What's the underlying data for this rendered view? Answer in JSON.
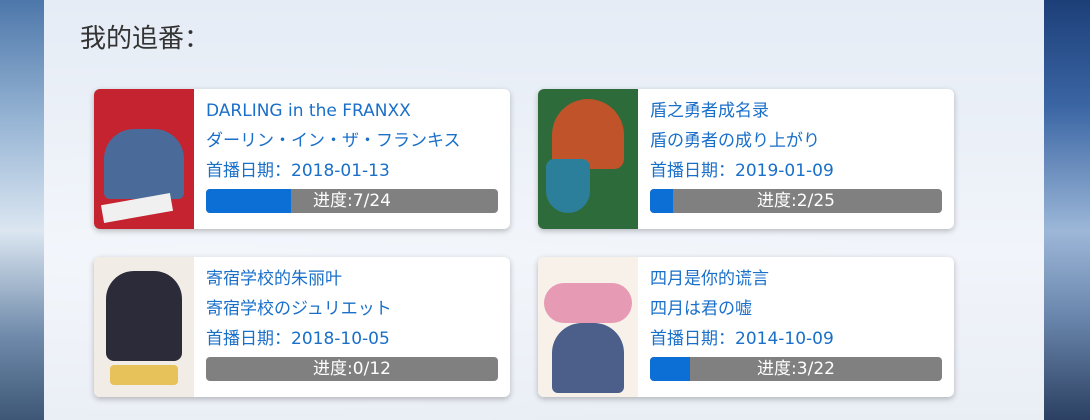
{
  "section": {
    "title": "我的追番："
  },
  "shows": [
    {
      "title_cn": "DARLING in the FRANXX",
      "title_jp": "ダーリン・イン・ザ・フランキス",
      "air_date_label": "首播日期：",
      "air_date": "2018-01-13",
      "progress_label": "进度:7/24",
      "progress": 0.2917,
      "cover_colors": [
        "#c4232f",
        "#4a6b9a",
        "#f0f0f0"
      ]
    },
    {
      "title_cn": "盾之勇者成名录",
      "title_jp": "盾の勇者の成り上がり",
      "air_date_label": "首播日期：",
      "air_date": "2019-01-09",
      "progress_label": "进度:2/25",
      "progress": 0.08,
      "cover_colors": [
        "#2e6b3a",
        "#c0532a",
        "#2b7f9a"
      ]
    },
    {
      "title_cn": "寄宿学校的朱丽叶",
      "title_jp": "寄宿学校のジュリエット",
      "air_date_label": "首播日期：",
      "air_date": "2018-10-05",
      "progress_label": "进度:0/12",
      "progress": 0.0,
      "cover_colors": [
        "#f2ece6",
        "#2b2b3a",
        "#e7c15a"
      ]
    },
    {
      "title_cn": "四月是你的谎言",
      "title_jp": "四月は君の嘘",
      "air_date_label": "首播日期：",
      "air_date": "2014-10-09",
      "progress_label": "进度:3/22",
      "progress": 0.1364,
      "cover_colors": [
        "#f7f1ea",
        "#e79ab4",
        "#4b5f8a"
      ]
    }
  ]
}
